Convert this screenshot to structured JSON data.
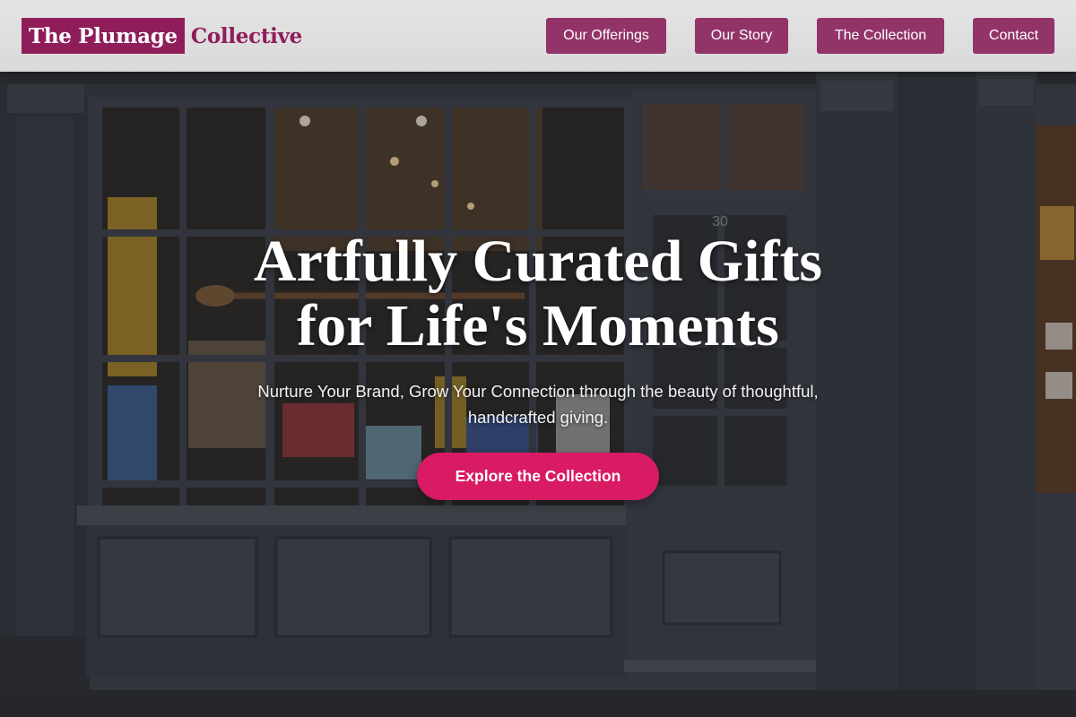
{
  "brand": {
    "name_part1": "The Plumage",
    "name_part2": "Collective"
  },
  "nav": {
    "items": [
      {
        "label": "Our Offerings"
      },
      {
        "label": "Our Story"
      },
      {
        "label": "The Collection"
      },
      {
        "label": "Contact"
      }
    ]
  },
  "hero": {
    "title_line1": "Artfully Curated Gifts",
    "title_line2": "for Life's Moments",
    "subtitle": "Nurture Your Brand, Grow Your Connection through the beauty of thoughtful, handcrafted giving.",
    "cta_label": "Explore the Collection",
    "image_description_icon": "storefront-image",
    "door_number": "30"
  },
  "colors": {
    "brand_primary": "#8e1d5a",
    "nav_button": "#923468",
    "cta": "#d81b62",
    "header_bg": "#dedede",
    "storefront": "#3a3f47"
  }
}
